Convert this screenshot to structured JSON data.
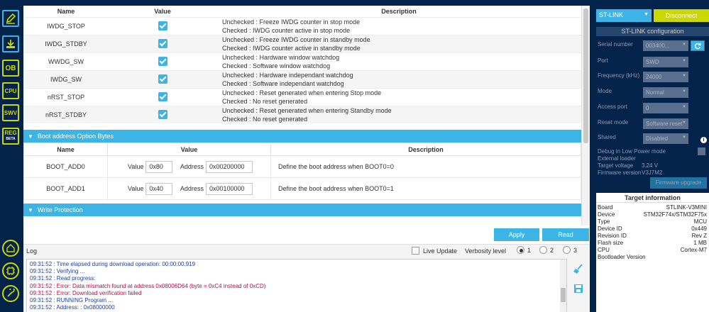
{
  "option_bytes_table": {
    "headers": [
      "Name",
      "Value",
      "Description"
    ],
    "rows": [
      {
        "name": "IWDG_STOP",
        "checked": true,
        "desc1": "Unchecked : Freeze IWDG counter in stop mode",
        "desc2": "Checked     : IWDG counter active in stop mode"
      },
      {
        "name": "IWDG_STDBY",
        "checked": true,
        "desc1": "Unchecked : Freeze IWDG counter in standby mode",
        "desc2": "Checked     : IWDG counter active in standby mode"
      },
      {
        "name": "WWDG_SW",
        "checked": true,
        "desc1": "Unchecked : Hardware window watchdog",
        "desc2": "Checked     : Software window watchdog"
      },
      {
        "name": "IWDG_SW",
        "checked": true,
        "desc1": "Unchecked : Hardware independant watchdog",
        "desc2": "Checked     : Software independant watchdog"
      },
      {
        "name": "nRST_STOP",
        "checked": true,
        "desc1": "Unchecked : Reset generated when entering Stop mode",
        "desc2": "Checked     : No reset generated"
      },
      {
        "name": "nRST_STDBY",
        "checked": true,
        "desc1": "Unchecked : Reset generated when entering Standby mode",
        "desc2": "Checked     : No reset generated"
      }
    ]
  },
  "boot_section": {
    "title": "Boot address Option Bytes",
    "headers": [
      "Name",
      "Value",
      "Description"
    ],
    "value_label": "Value",
    "address_label": "Address",
    "rows": [
      {
        "name": "BOOT_ADD0",
        "value": "0x80",
        "address": "0x00200000",
        "desc": "Define the boot address when BOOT0=0"
      },
      {
        "name": "BOOT_ADD1",
        "value": "0x40",
        "address": "0x00100000",
        "desc": "Define the boot address when BOOT0=1"
      }
    ]
  },
  "write_protection": {
    "title": "Write Protection"
  },
  "actions": {
    "apply": "Apply",
    "read": "Read"
  },
  "log": {
    "title": "Log",
    "live_update": "Live Update",
    "verbosity_label": "Verbosity level",
    "verbosity_options": [
      "1",
      "2",
      "3"
    ],
    "verbosity_selected": "1",
    "lines": [
      {
        "type": "info",
        "text": "09:31:52 : Time elapsed during download operation: 00:00:00.919"
      },
      {
        "type": "info",
        "text": "09:31:52 : Verifying ..."
      },
      {
        "type": "info",
        "text": "09:31:52 : Read progress:"
      },
      {
        "type": "err",
        "text": "09:31:52 : Error: Data mismatch found at address  0x08006D64 (byte = 0xC4 instead of 0xCD)"
      },
      {
        "type": "err",
        "text": "09:31:52 : Error: Download verification failed"
      },
      {
        "type": "info",
        "text": "09:31:52 : RUNNING Program ..."
      },
      {
        "type": "info",
        "text": "09:31:52 :   Address:      : 0x08000000"
      }
    ]
  },
  "stlink": {
    "selector": "ST-LINK",
    "disconnect": "Disconnect",
    "config_title": "ST-LINK configuration",
    "fields": {
      "serial_number": {
        "label": "Serial number",
        "value": "003400..."
      },
      "port": {
        "label": "Port",
        "value": "SWD"
      },
      "frequency": {
        "label": "Frequency (kHz)",
        "value": "24000"
      },
      "mode": {
        "label": "Mode",
        "value": "Normal"
      },
      "access_port": {
        "label": "Access port",
        "value": "0"
      },
      "reset_mode": {
        "label": "Reset mode",
        "value": "Software reset"
      },
      "shared": {
        "label": "Shared",
        "value": "Disabled"
      }
    },
    "debug_low_power": "Debug in Low Power mode",
    "external_loader": "External loader",
    "target_voltage_label": "Target voltage",
    "target_voltage": "3.24 V",
    "firmware_version_label": "Firmware version",
    "firmware_version": "V3J7M2",
    "firmware_upgrade": "Firmware upgrade"
  },
  "target_info": {
    "title": "Target information",
    "rows": [
      {
        "k": "Board",
        "v": "STLINK-V3MINI"
      },
      {
        "k": "Device",
        "v": "STM32F74x/STM32F75x"
      },
      {
        "k": "Type",
        "v": "MCU"
      },
      {
        "k": "Device ID",
        "v": "0x449"
      },
      {
        "k": "Revision ID",
        "v": "Rev Z"
      },
      {
        "k": "Flash size",
        "v": "1 MB"
      },
      {
        "k": "CPU",
        "v": "Cortex-M7"
      },
      {
        "k": "Bootloader Version",
        "v": ""
      }
    ]
  },
  "sidebar": {
    "ob": "OB",
    "cpu": "CPU",
    "swv": "SWV",
    "reg": "REG"
  },
  "colors": {
    "accent": "#3cb4e6",
    "nav_bg": "#03234b",
    "lime": "#ccd600",
    "error": "#b0104a"
  }
}
